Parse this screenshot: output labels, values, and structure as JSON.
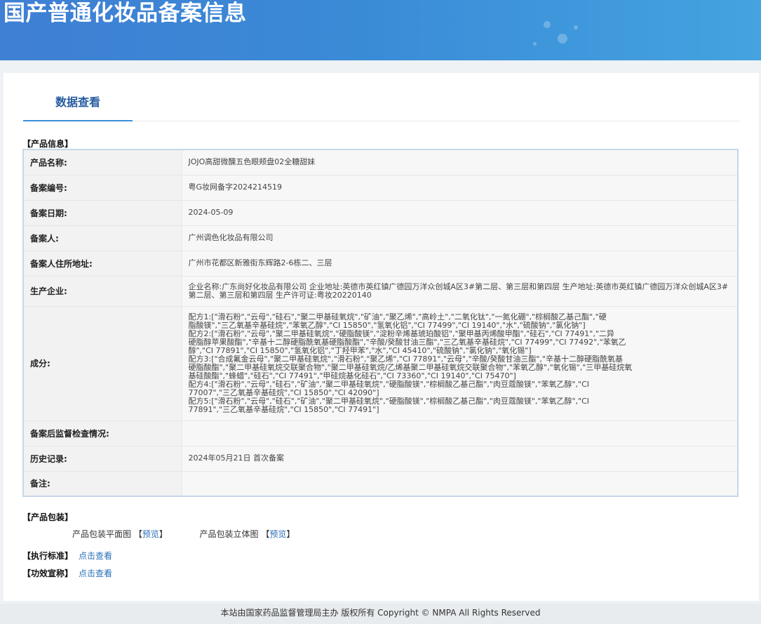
{
  "header": {
    "title": "国产普通化妆品备案信息"
  },
  "tabs": [
    {
      "label": "数据查看"
    }
  ],
  "product_info": {
    "section_label": "【产品信息】",
    "rows": [
      {
        "label": "产品名称:",
        "value": "JOJO高甜微醺五色眼颊盘02全糖甜妹"
      },
      {
        "label": "备案编号:",
        "value": "粤G妆网备字2024214519"
      },
      {
        "label": "备案日期:",
        "value": "2024-05-09"
      },
      {
        "label": "备案人:",
        "value": "广州调色化妆品有限公司"
      },
      {
        "label": "备案人住所地址:",
        "value": "广州市花都区新雅街东辉路2-6栋二、三层"
      },
      {
        "label": "生产企业:",
        "value": "企业名称:广东尚好化妆品有限公司 企业地址:英德市英红镇广德园万洋众创城A区3#第二层、第三层和第四层 生产地址:英德市英红镇广德园万洋众创城A区3#第二层、第三层和第四层 生产许可证:粤妆20220140"
      },
      {
        "label": "成分:",
        "lines": [
          "配方1:[\"滑石粉\",\"云母\",\"硅石\",\"聚二甲基硅氧烷\",\"矿油\",\"聚乙烯\",\"高岭土\",\"二氧化钛\",\"一氮化硼\",\"棕榈酸乙基己酯\",\"硬",
          "脂酸镁\",\"三乙氧基辛基硅烷\",\"苯氧乙醇\",\"CI 15850\",\"氢氧化铝\",\"CI 77499\",\"CI 19140\",\"水\",\"硫酸钠\",\"氯化钠\"]",
          "配方2:[\"滑石粉\",\"云母\",\"聚二甲基硅氧烷\",\"硬脂酸镁\",\"淀粉辛烯基琥珀酸铝\",\"聚甲基丙烯酸甲酯\",\"硅石\",\"CI 77491\",\"二异",
          "硬脂醇苹果酸酯\",\"辛基十二醇硬脂酰氧基硬脂酸酯\",\"辛酸/癸酸甘油三酯\",\"三乙氧基辛基硅烷\",\"CI 77499\",\"CI 77492\",\"苯氧乙",
          "醇\",\"CI 77891\",\"CI 15850\",\"氢氧化铝\",\"丁羟甲苯\",\"水\",\"CI 45410\",\"硫酸钠\",\"氯化钠\",\"氧化锡\"]",
          "配方3:[\"合成氟金云母\",\"聚二甲基硅氧烷\",\"滑石粉\",\"聚乙烯\",\"CI 77891\",\"云母\",\"辛酸/癸酸甘油三酯\",\"辛基十二醇硬脂酰氧基",
          "硬脂酸酯\",\"聚二甲基硅氧烷交联聚合物\",\"聚二甲基硅氧烷/乙烯基聚二甲基硅氧烷交联聚合物\",\"苯氧乙醇\",\"氧化锡\",\"三甲基硅烷氧",
          "基硅酸酯\",\"蜂蜡\",\"硅石\",\"CI 77491\",\"甲硅烷基化硅石\",\"CI 73360\",\"CI 19140\",\"CI 75470\"]",
          "配方4:[\"滑石粉\",\"云母\",\"硅石\",\"矿油\",\"聚二甲基硅氧烷\",\"硬脂酸镁\",\"棕榈酸乙基己酯\",\"肉豆蔻酸镁\",\"苯氧乙醇\",\"CI",
          "77007\",\"三乙氧基辛基硅烷\",\"CI 15850\",\"CI 42090\"]",
          "配方5:[\"滑石粉\",\"云母\",\"硅石\",\"矿油\",\"聚二甲基硅氧烷\",\"硬脂酸镁\",\"棕榈酸乙基己酯\",\"肉豆蔻酸镁\",\"苯氧乙醇\",\"CI",
          "77891\",\"三乙氧基辛基硅烷\",\"CI 15850\",\"CI 77491\"]"
        ]
      },
      {
        "label": "备案后监督检查情况:",
        "value": ""
      },
      {
        "label": "历史记录:",
        "value": "2024年05月21日 首次备案"
      },
      {
        "label": "备注:",
        "value": ""
      }
    ]
  },
  "packaging": {
    "section_label": "【产品包装】",
    "flat_label": "产品包装平面图",
    "stereo_label": "产品包装立体图",
    "preview_link": "预览",
    "bracket_open": "【",
    "bracket_close": "】"
  },
  "standards": {
    "label": "【执行标准】",
    "link": "点击查看"
  },
  "efficacy": {
    "label": "【功效宣称】",
    "link": "点击查看"
  },
  "footer": {
    "text": "本站由国家药品监督管理局主办 版权所有 Copyright © NMPA All Rights Reserved"
  },
  "colors": {
    "banner": "#3f7fd4",
    "tab_accent": "#3b8fd7",
    "link": "#2a6fb8"
  }
}
